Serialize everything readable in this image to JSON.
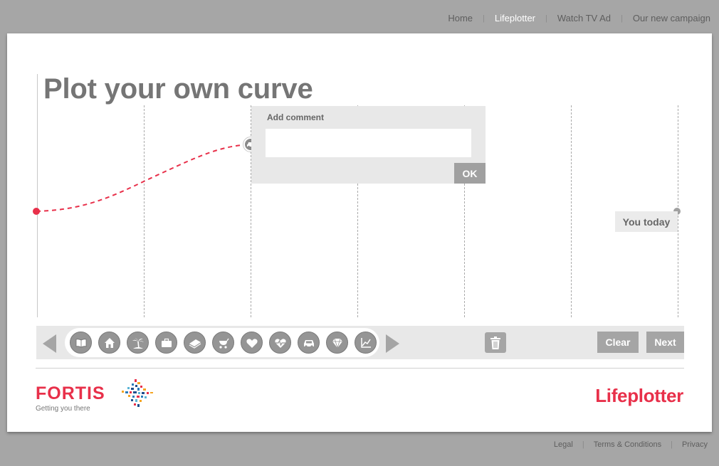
{
  "topnav": {
    "items": [
      {
        "label": "Home"
      },
      {
        "label": "Lifeplotter"
      },
      {
        "label": "Watch TV Ad"
      },
      {
        "label": "Our new campaign"
      }
    ],
    "separator": "|",
    "active": "Lifeplotter"
  },
  "page": {
    "title": "Plot your own curve"
  },
  "comment": {
    "label": "Add comment",
    "value": "",
    "ok_label": "OK"
  },
  "plot": {
    "end_label": "You today",
    "colors": {
      "curve": "#e8304a",
      "start_point": "#e8304a",
      "end_point": "#a0a0a0"
    }
  },
  "toolbar": {
    "icons": [
      {
        "name": "book-icon"
      },
      {
        "name": "house-icon"
      },
      {
        "name": "palm-tree-icon"
      },
      {
        "name": "briefcase-icon"
      },
      {
        "name": "money-icon"
      },
      {
        "name": "baby-stroller-icon"
      },
      {
        "name": "heart-icon"
      },
      {
        "name": "heartbeat-icon"
      },
      {
        "name": "car-icon"
      },
      {
        "name": "diamond-icon"
      },
      {
        "name": "chart-icon"
      }
    ],
    "clear_label": "Clear",
    "next_label": "Next"
  },
  "brand": {
    "fortis_word": "FORTIS",
    "fortis_tagline": "Getting you there",
    "app_name": "Lifeplotter",
    "accent_color": "#e8304a"
  },
  "bottomnav": {
    "items": [
      {
        "label": "Legal"
      },
      {
        "label": "Terms & Conditions"
      },
      {
        "label": "Privacy"
      }
    ],
    "separator": "|"
  }
}
